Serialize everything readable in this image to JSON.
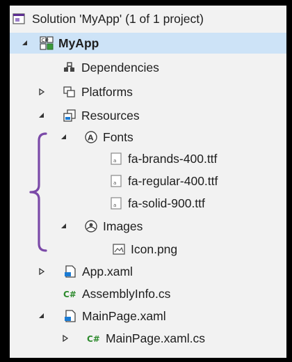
{
  "solution_explorer": {
    "items": [
      {
        "label": "Solution 'MyApp' (1 of 1 project)",
        "icon": "solution-icon",
        "expander": "none",
        "selected": false
      },
      {
        "label": "MyApp",
        "icon": "project-icon",
        "expander": "expanded",
        "selected": true,
        "bold": true
      },
      {
        "label": "Dependencies",
        "icon": "dependencies-icon",
        "expander": "none",
        "selected": false
      },
      {
        "label": "Platforms",
        "icon": "folder-icon",
        "expander": "collapsed",
        "selected": false
      },
      {
        "label": "Resources",
        "icon": "folder-icon",
        "expander": "expanded",
        "selected": false
      },
      {
        "label": "Fonts",
        "icon": "fonts-folder-icon",
        "expander": "expanded",
        "selected": false
      },
      {
        "label": "fa-brands-400.ttf",
        "icon": "font-file-icon",
        "expander": "none",
        "selected": false
      },
      {
        "label": "fa-regular-400.ttf",
        "icon": "font-file-icon",
        "expander": "none",
        "selected": false
      },
      {
        "label": "fa-solid-900.ttf",
        "icon": "font-file-icon",
        "expander": "none",
        "selected": false
      },
      {
        "label": "Images",
        "icon": "images-folder-icon",
        "expander": "expanded",
        "selected": false
      },
      {
        "label": "Icon.png",
        "icon": "image-file-icon",
        "expander": "none",
        "selected": false
      },
      {
        "label": "App.xaml",
        "icon": "xaml-file-icon",
        "expander": "collapsed",
        "selected": false
      },
      {
        "label": "AssemblyInfo.cs",
        "icon": "csharp-file-icon",
        "expander": "none",
        "selected": false
      },
      {
        "label": "MainPage.xaml",
        "icon": "xaml-file-icon",
        "expander": "expanded",
        "selected": false
      },
      {
        "label": "MainPage.xaml.cs",
        "icon": "csharp-file-icon",
        "expander": "collapsed",
        "selected": false
      }
    ],
    "annotation_color": "#7b4aa8",
    "selection_color": "#cde3f7"
  }
}
